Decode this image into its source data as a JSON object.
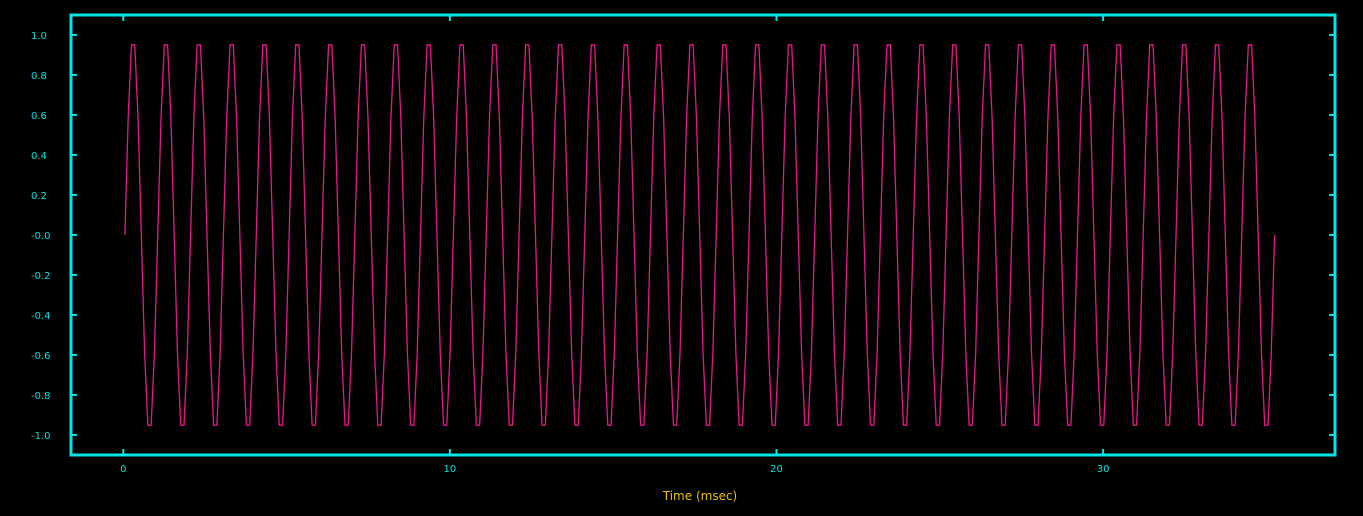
{
  "chart_data": {
    "type": "line",
    "title": "",
    "xlabel": "Time (msec)",
    "ylabel": "",
    "xlim": [
      -1.6,
      37.1
    ],
    "ylim": [
      -1.1,
      1.1
    ],
    "x_ticks": [
      0,
      10,
      20,
      30
    ],
    "x_tick_labels": [
      "0",
      "10",
      "20",
      "30"
    ],
    "y_ticks": [
      1.0,
      0.8,
      0.6,
      0.4,
      0.2,
      0.0,
      -0.2,
      -0.4,
      -0.6,
      -0.8,
      -1.0
    ],
    "y_tick_labels": [
      "1.0",
      "0.8",
      "0.6",
      "0.4",
      "0.2",
      "-0.0",
      "-0.2",
      "-0.4",
      "-0.6",
      "-0.8",
      "-1.0"
    ],
    "grid": false,
    "series": [
      {
        "color": "#e8168c",
        "x_start": 0.05,
        "x_end": 35.25,
        "cycles": 35,
        "amplitude": 1.0,
        "sample_count": 351,
        "waveform": "sine"
      }
    ],
    "colors": {
      "background": "#000000",
      "frame": "#00e5e5",
      "tick_label": "#00e5e5",
      "axis_label": "#e6c000",
      "line": "#e8168c"
    }
  }
}
